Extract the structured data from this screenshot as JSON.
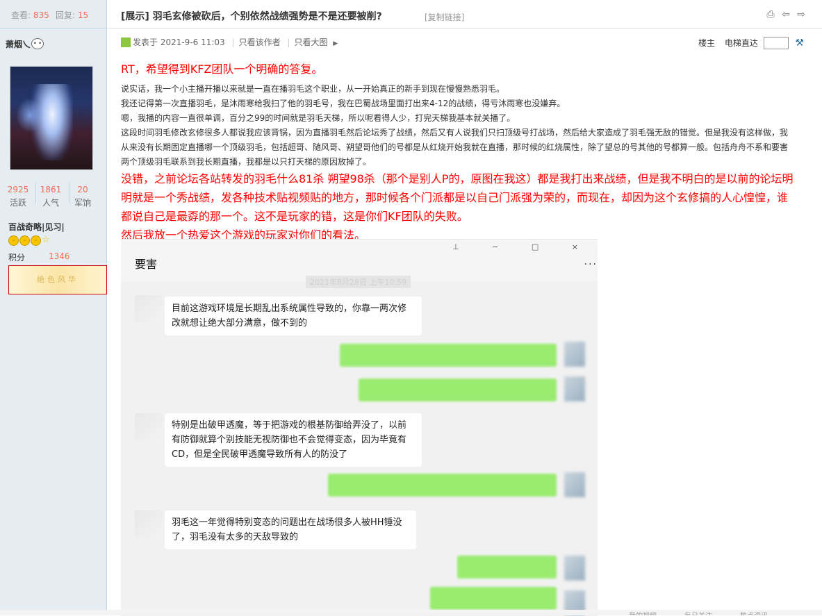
{
  "sidebar": {
    "views_label": "查看:",
    "views": "835",
    "replies_label": "回复:",
    "replies": "15",
    "username": "萧烟乀",
    "counts": [
      {
        "value": "2925",
        "label": "活跃"
      },
      {
        "value": "1861",
        "label": "人气"
      },
      {
        "value": "20",
        "label": "军饷"
      }
    ],
    "group": "百战奇略|见习|",
    "points_label": "积分",
    "points": "1346",
    "medal_text": "绝色风华"
  },
  "thread": {
    "title": "[展示] 羽毛玄修被砍后，个别依然战绩强势是不是还要被削?",
    "copy_link": "[复制链接]",
    "posted": "发表于 2021-9-6 11:03",
    "only_author": "只看该作者",
    "only_big_images": "只看大图",
    "floor_label": "楼主",
    "elevator_label": "电梯直达"
  },
  "post": {
    "line1": "RT，希望得到KFZ团队一个明确的答复。",
    "para1": "说实话，我一个小主播开播以来就是一直在播羽毛这个职业，从一开始真正的新手到现在慢慢熟悉羽毛。",
    "para2": "我还记得第一次直播羽毛，是沐雨寒给我扫了他的羽毛号，我在巴蜀战场里面打出来4-12的战绩，得亏沐雨寒也没嫌弃。",
    "para3": "嗯，我播的内容一直很单调，百分之99的时间就是羽毛天梯，所以呢看得人少，打完天梯我基本就关播了。",
    "para4": "这段时间羽毛修改玄修很多人都说我应该背锅，因为直播羽毛然后论坛秀了战绩，然后又有人说我们只扫顶级号打战场，然后给大家造成了羽毛强无敌的错觉。但是我没有这样做，我从来没有长期固定直播哪一个顶级羽毛，包括超哥、随风哥、朔望哥他们的号都是从红烧开始我就在直播，那时候的红烧属性，除了望总的号其他的号都算一般。包括舟舟不系和要害两个顶级羽毛联系到我长期直播，我都是以只打天梯的原因放掉了。",
    "red_para": "没错，之前论坛各站转发的羽毛什么81杀  朔望98杀（那个是别人P的，原图在我这）都是我打出来战绩，但是我不明白的是以前的论坛明明就是一个秀战绩，发各种技术贴视频贴的地方，那时候各个门派都是以自己门派强为荣的，而现在，却因为这个玄修搞的人心惶惶，谁都说自己是最孬的那一个。这不是玩家的错，这是你们KF团队的失败。",
    "red_last": "然后我放一个热爱这个游戏的玩家对你们的看法。"
  },
  "chat": {
    "title": "要害",
    "controls": "⊥ − □ ×",
    "more": "···",
    "timestamp": "2021年8月28日 上午10:59",
    "messages": [
      "目前这游戏环境是长期乱出系统属性导致的，你靠一两次修改就想让绝大部分满意，做不到的",
      "特别是出破甲透魔，等于把游戏的根基防御给弄没了，以前有防御就算个别技能无视防御也不会觉得变态，因为毕竟有CD，但是全民破甲透魔导致所有人的防没了",
      "羽毛这一年觉得特别变态的问题出在战场很多人被HH锤没了，羽毛没有太多的天敌导致的"
    ]
  },
  "footer": {
    "items": [
      "我的视频",
      "每日关注",
      "热点资讯"
    ]
  },
  "colors": {
    "accent_red": "#ff0000",
    "stat_orange": "#f26c4f",
    "sidebar_bg": "#e5edf2",
    "bubble_green": "#95ec69"
  }
}
